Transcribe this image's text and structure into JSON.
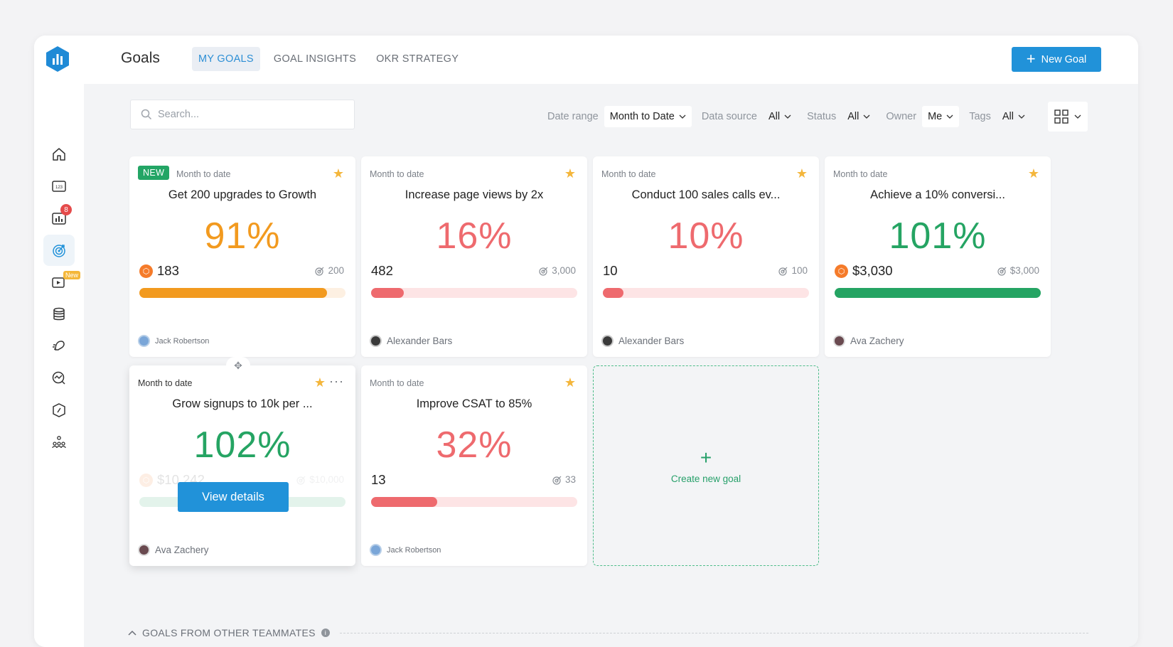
{
  "header": {
    "title": "Goals",
    "tabs": [
      "MY GOALS",
      "GOAL INSIGHTS",
      "OKR STRATEGY"
    ],
    "new_goal": "New Goal"
  },
  "sidebar": {
    "badge_count": "8",
    "badge_new": "New"
  },
  "search": {
    "placeholder": "Search..."
  },
  "filters": {
    "date_range_label": "Date range",
    "date_range_value": "Month to Date",
    "data_source_label": "Data source",
    "data_source_value": "All",
    "status_label": "Status",
    "status_value": "All",
    "owner_label": "Owner",
    "owner_value": "Me",
    "tags_label": "Tags",
    "tags_value": "All"
  },
  "cards": [
    {
      "badge": "NEW",
      "period": "Month to date",
      "title": "Get 200 upgrades to Growth",
      "percent": "91%",
      "current": "183",
      "target": "200",
      "owner": "Jack Robertson",
      "progress": 0.91,
      "color": "#f29a1f",
      "track": "#fdf0e2"
    },
    {
      "period": "Month to date",
      "title": "Increase page views by 2x",
      "percent": "16%",
      "current": "482",
      "target": "3,000",
      "owner": "Alexander Bars",
      "progress": 0.16,
      "color": "#ee6a6e",
      "track": "#fde4e5"
    },
    {
      "period": "Month to date",
      "title": "Conduct 100 sales calls ev...",
      "percent": "10%",
      "current": "10",
      "target": "100",
      "owner": "Alexander Bars",
      "progress": 0.1,
      "color": "#ee6a6e",
      "track": "#fde4e5"
    },
    {
      "period": "Month to date",
      "title": "Achieve a 10% conversi...",
      "percent": "101%",
      "current": "$3,030",
      "target": "$3,000",
      "owner": "Ava Zachery",
      "progress": 1.0,
      "color": "#25a463",
      "track": "#e0f3e9"
    },
    {
      "period": "Month to date",
      "title": "Grow signups to 10k per ...",
      "percent": "102%",
      "current": "$10,242",
      "target": "$10,000",
      "owner": "Ava Zachery",
      "progress": 1.0,
      "color": "#25a463",
      "track": "#e0f3e9",
      "action": "View details"
    },
    {
      "period": "Month to date",
      "title": "Improve CSAT to 85%",
      "percent": "32%",
      "current": "13",
      "target": "33",
      "owner": "Jack Robertson",
      "progress": 0.32,
      "color": "#ee6a6e",
      "track": "#fde4e5"
    }
  ],
  "create_goal": "Create new goal",
  "others_section": "GOALS FROM OTHER TEAMMATES",
  "colors": {
    "accent": "#2192d9",
    "green": "#25a463",
    "red": "#ee6a6e",
    "orange": "#f29a1f"
  }
}
